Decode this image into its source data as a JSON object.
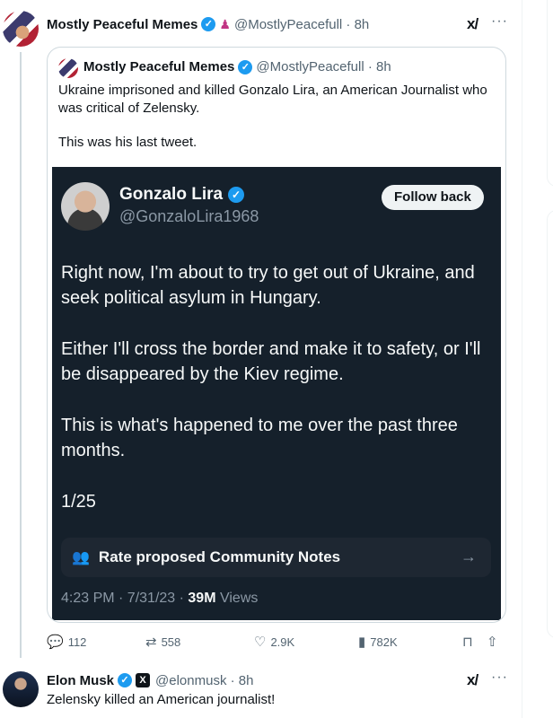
{
  "tweet": {
    "author_name": "Mostly Peaceful Memes",
    "handle_time": "@MostlyPeacefull · 8h"
  },
  "quote": {
    "author_name": "Mostly Peaceful Memes",
    "handle_time": "@MostlyPeacefull · 8h",
    "text_1": "Ukraine imprisoned and killed Gonzalo Lira, an American Journalist who was critical of Zelensky.",
    "text_2": "This was his last tweet."
  },
  "screenshot": {
    "name": "Gonzalo Lira",
    "handle": "@GonzaloLira1968",
    "follow_label": "Follow back",
    "paragraphs": [
      "Right now, I'm about to try to get out of Ukraine, and seek political asylum in Hungary.",
      "Either I'll cross the border and make it to safety, or I'll be disappeared by the Kiev regime.",
      "This is what's happened to me over the past three months.",
      "1/25"
    ],
    "notes_label": "Rate proposed Community Notes",
    "time_date": "4:23 PM · 7/31/23 · ",
    "views_count": "39M",
    "views_label": " Views"
  },
  "actions": {
    "replies": "112",
    "reposts": "558",
    "likes": "2.9K",
    "views": "782K"
  },
  "reply": {
    "author_name": "Elon Musk",
    "handle_time": "@elonmusk · 8h",
    "text": "Zelensky killed an American journalist!"
  },
  "icons": {
    "verified": "verified-badge-icon",
    "grok": "grok-icon",
    "more": "more-icon"
  },
  "colors": {
    "accent": "#1d9bf0",
    "dark_bg": "#15202b"
  }
}
